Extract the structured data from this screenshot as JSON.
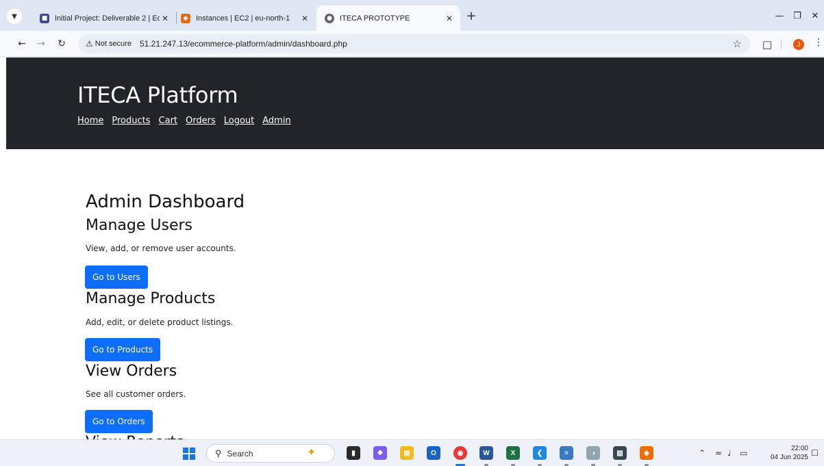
{
  "browser": {
    "tabs": [
      {
        "title": "Initial Project: Deliverable 2 | Ed",
        "favicon": "ed-icon",
        "active": false
      },
      {
        "title": "Instances | EC2 | eu-north-1",
        "favicon": "aws-icon",
        "active": false
      },
      {
        "title": "ITECA PROTOTYPE",
        "favicon": "globe-icon",
        "active": true
      }
    ],
    "new_tab": "+",
    "address": {
      "security_label": "Not secure",
      "url": "51.21.247.13/ecommerce-platform/admin/dashboard.php"
    },
    "profile_initial": "J"
  },
  "site": {
    "title": "ITECA Platform",
    "nav": [
      "Home",
      "Products",
      "Cart",
      "Orders",
      "Logout",
      "Admin"
    ]
  },
  "dashboard": {
    "title": "Admin Dashboard",
    "sections": [
      {
        "title": "Manage Users",
        "description": "View, add, or remove user accounts.",
        "button": "Go to Users"
      },
      {
        "title": "Manage Products",
        "description": "Add, edit, or delete product listings.",
        "button": "Go to Products"
      },
      {
        "title": "View Orders",
        "description": "See all customer orders.",
        "button": "Go to Orders"
      },
      {
        "title": "View Reports"
      }
    ]
  },
  "taskbar": {
    "search_placeholder": "Search",
    "time": "22:00",
    "date": "04 Jun 2025"
  },
  "colors": {
    "header_bg": "#212529",
    "primary_button": "#0d6efd",
    "profile_avatar": "#e8560f"
  }
}
